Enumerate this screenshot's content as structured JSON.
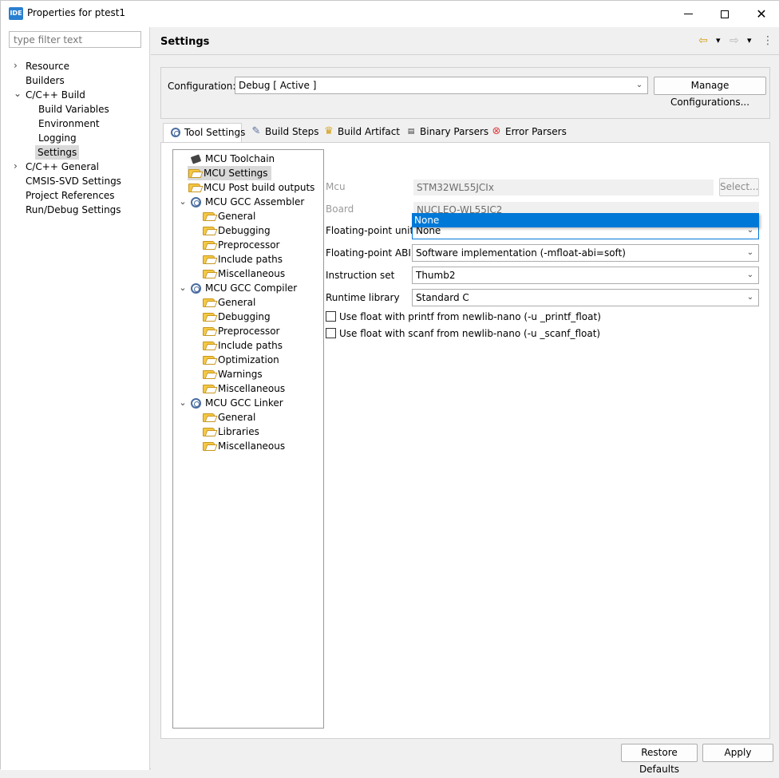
{
  "window": {
    "icon_text": "IDE",
    "title": "Properties for ptest1",
    "minimize": "—",
    "close": "✕"
  },
  "nav": {
    "filter_placeholder": "type filter text",
    "items": [
      {
        "label": "Resource"
      },
      {
        "label": "Builders"
      },
      {
        "label": "C/C++ Build"
      },
      {
        "label": "Build Variables"
      },
      {
        "label": "Environment"
      },
      {
        "label": "Logging"
      },
      {
        "label": "Settings"
      },
      {
        "label": "C/C++ General"
      },
      {
        "label": "CMSIS-SVD Settings"
      },
      {
        "label": "Project References"
      },
      {
        "label": "Run/Debug Settings"
      }
    ]
  },
  "header": {
    "title": "Settings",
    "back_icon": "⇦",
    "forward_icon": "⇨",
    "dropdown_icon": "▾",
    "menu_icon": "⋮"
  },
  "configuration": {
    "label": "Configuration:",
    "value": "Debug  [ Active ]",
    "manage_button": "Manage Configurations..."
  },
  "tabs": [
    {
      "label": "Tool Settings"
    },
    {
      "label": "Build Steps"
    },
    {
      "label": "Build Artifact"
    },
    {
      "label": "Binary Parsers"
    },
    {
      "label": "Error Parsers"
    }
  ],
  "tree": {
    "items": [
      {
        "label": "MCU Toolchain"
      },
      {
        "label": "MCU Settings"
      },
      {
        "label": "MCU Post build outputs"
      },
      {
        "label": "MCU GCC Assembler"
      },
      {
        "label": "General"
      },
      {
        "label": "Debugging"
      },
      {
        "label": "Preprocessor"
      },
      {
        "label": "Include paths"
      },
      {
        "label": "Miscellaneous"
      },
      {
        "label": "MCU GCC Compiler"
      },
      {
        "label": "General"
      },
      {
        "label": "Debugging"
      },
      {
        "label": "Preprocessor"
      },
      {
        "label": "Include paths"
      },
      {
        "label": "Optimization"
      },
      {
        "label": "Warnings"
      },
      {
        "label": "Miscellaneous"
      },
      {
        "label": "MCU GCC Linker"
      },
      {
        "label": "General"
      },
      {
        "label": "Libraries"
      },
      {
        "label": "Miscellaneous"
      }
    ]
  },
  "form": {
    "mcu_label": "Mcu",
    "mcu_value": "STM32WL55JCIx",
    "select_button": "Select...",
    "board_label": "Board",
    "board_value": "NUCLEO-WL55JC2",
    "fpu_label": "Floating-point unit",
    "fpu_value": "None",
    "fpu_dropdown_option": "None",
    "abi_label": "Floating-point ABI",
    "abi_value": "Software implementation (-mfloat-abi=soft)",
    "instruction_label": "Instruction set",
    "instruction_value": "Thumb2",
    "runtime_label": "Runtime library",
    "runtime_value": "Standard C",
    "printf_float_label": "Use float with printf from newlib-nano (-u _printf_float)",
    "scanf_float_label": "Use float with scanf from newlib-nano (-u _scanf_float)"
  },
  "footer": {
    "restore_button": "Restore Defaults",
    "apply_button": "Apply"
  },
  "colors": {
    "accent": "#0078d7",
    "selection": "#d9d9d9"
  }
}
